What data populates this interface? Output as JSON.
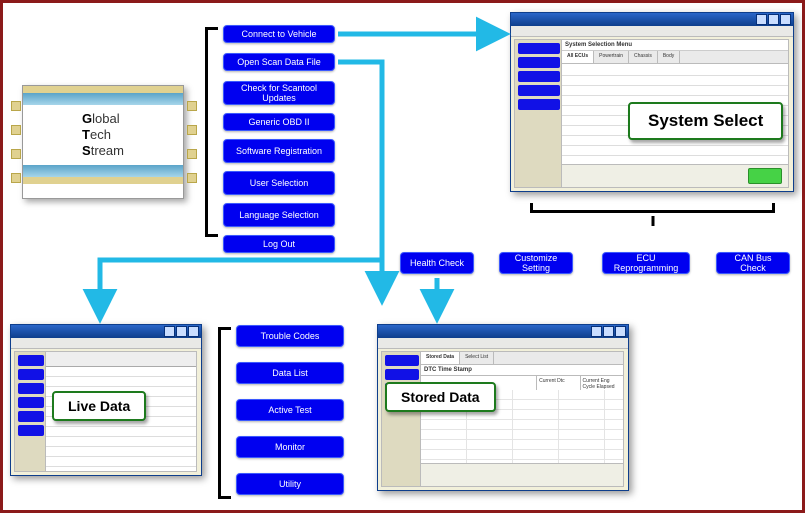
{
  "splash": {
    "line1_initial": "G",
    "line1_rest": "lobal",
    "line2_initial": "T",
    "line2_rest": "ech",
    "line3_initial": "S",
    "line3_rest": "tream"
  },
  "menu1": {
    "connect": "Connect to Vehicle",
    "open": "Open Scan Data File",
    "check": "Check for Scantool Updates",
    "obd": "Generic OBD II",
    "software": "Software Registration",
    "user": "User Selection",
    "language": "Language Selection",
    "logout": "Log Out"
  },
  "callouts": {
    "system": "System Select",
    "live": "Live Data",
    "stored": "Stored Data"
  },
  "select_row": {
    "health": "Health Check",
    "customize": "Customize Setting",
    "ecu": "ECU Reprogramming",
    "can": "CAN Bus Check"
  },
  "menu2": {
    "trouble": "Trouble Codes",
    "datalist": "Data List",
    "active": "Active Test",
    "monitor": "Monitor",
    "utility": "Utility"
  },
  "windows": {
    "system_select_title": "System Selection Menu",
    "stored_title": "DTC Time Stamp",
    "stored_col1": "Current Dtc",
    "stored_col2": "Current Eng Cycle Elapsed"
  }
}
